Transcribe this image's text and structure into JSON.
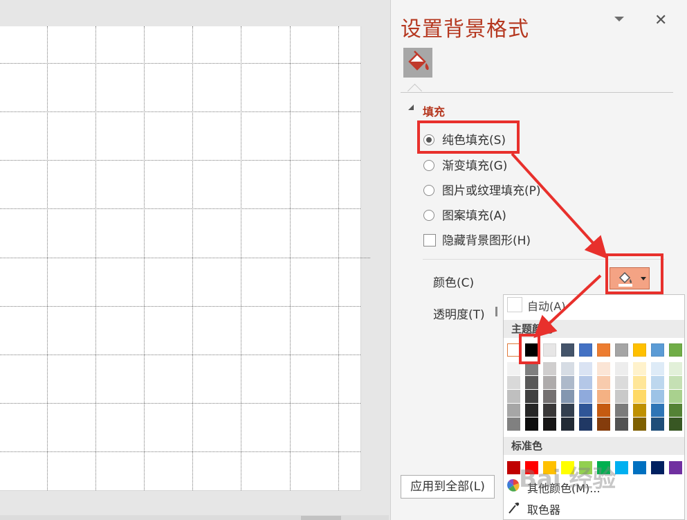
{
  "pane": {
    "title": "设置背景格式",
    "close_glyph": "✕",
    "tab_icon": "paint-bucket-icon"
  },
  "fill": {
    "section_title": "填充",
    "options": [
      {
        "label": "纯色填充(S)",
        "type": "radio",
        "selected": true
      },
      {
        "label": "渐变填充(G)",
        "type": "radio",
        "selected": false
      },
      {
        "label": "图片或纹理填充(P)",
        "type": "radio",
        "selected": false
      },
      {
        "label": "图案填充(A)",
        "type": "radio",
        "selected": false
      },
      {
        "label": "隐藏背景图形(H)",
        "type": "checkbox",
        "selected": false
      }
    ],
    "color_label": "颜色(C)",
    "transparency_label": "透明度(T)",
    "color_button_color": "#f4a384"
  },
  "apply_all_label": "应用到全部(L)",
  "color_popup": {
    "auto_label": "自动(A)",
    "theme_header": "主题颜色",
    "standard_header": "标准色",
    "more_colors_label": "其他颜色(M)...",
    "eyedropper_label": "取色器",
    "theme_colors": [
      "#ffffff",
      "#000000",
      "#e7e6e6",
      "#44546a",
      "#4472c4",
      "#ed7d31",
      "#a5a5a5",
      "#ffc000",
      "#5b9bd5",
      "#70ad47"
    ],
    "theme_shades": [
      [
        "#f2f2f2",
        "#d9d9d9",
        "#bfbfbf",
        "#a6a6a6",
        "#808080"
      ],
      [
        "#7f7f7f",
        "#595959",
        "#404040",
        "#262626",
        "#0d0d0d"
      ],
      [
        "#d0cece",
        "#aeabab",
        "#757171",
        "#3a3838",
        "#171616"
      ],
      [
        "#d6dce4",
        "#adb9ca",
        "#8497b0",
        "#333f4f",
        "#222a35"
      ],
      [
        "#dae3f3",
        "#b4c7e7",
        "#8faadc",
        "#2f5597",
        "#203864"
      ],
      [
        "#fbe5d6",
        "#f8cbad",
        "#f4b183",
        "#c55a11",
        "#843c0c"
      ],
      [
        "#ededed",
        "#dbdbdb",
        "#c9c9c9",
        "#7b7b7b",
        "#525252"
      ],
      [
        "#fff2cc",
        "#ffe699",
        "#ffd966",
        "#bf9000",
        "#7f6000"
      ],
      [
        "#deebf7",
        "#bdd7ee",
        "#9dc3e6",
        "#2e75b6",
        "#1f4e79"
      ],
      [
        "#e2f0d9",
        "#c5e0b4",
        "#a9d18e",
        "#548235",
        "#385723"
      ]
    ],
    "standard_colors": [
      "#c00000",
      "#ff0000",
      "#ffc000",
      "#ffff00",
      "#92d050",
      "#00b050",
      "#00b0f0",
      "#0070c0",
      "#002060",
      "#7030a0"
    ]
  },
  "watermark_text": "Bai 经验"
}
